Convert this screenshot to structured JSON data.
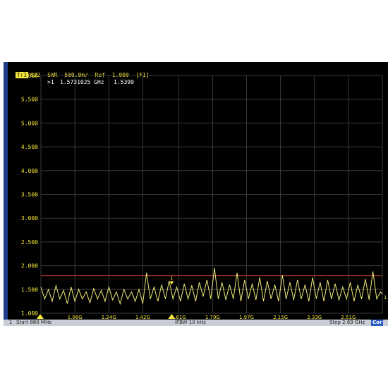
{
  "title_bar": {
    "trace": "Tr1",
    "text": "S22  SWR  500.0m/  Ref  1.000  [F1]"
  },
  "marker": {
    "readout_id": ">1",
    "readout_freq": "1.5731025 GHz",
    "readout_value": "1.5390",
    "label": "1",
    "end_label": "1"
  },
  "status_bar": {
    "channel": "1",
    "start": "Start 880 MHz",
    "ifbw": "IFBW 10 kHz",
    "stop": "Stop 2.69 GHz",
    "badge": "Cor"
  },
  "colors": {
    "trace": "#f0ea7a",
    "limit_line": "#b23a2a",
    "grid": "#3a3a3a",
    "axis_text": "#f4e83a"
  },
  "chart_data": {
    "type": "line",
    "title": "S22 SWR 500.0m/ Ref 1.000 [F1]",
    "xlabel": "",
    "ylabel": "",
    "xlim": [
      0.88,
      2.69
    ],
    "ylim": [
      1.0,
      6.0
    ],
    "y_ticks": [
      "6.000",
      "5.500",
      "5.000",
      "4.500",
      "4.000",
      "3.500",
      "3.000",
      "2.500",
      "2.000",
      "1.500",
      "1.000"
    ],
    "y_tick_values": [
      6.0,
      5.5,
      5.0,
      4.5,
      4.0,
      3.5,
      3.0,
      2.5,
      2.0,
      1.5,
      1.0
    ],
    "x_ticks": [
      "1.06G",
      "1.24G",
      "1.42G",
      "1.61G",
      "1.79G",
      "1.97G",
      "2.15G",
      "2.33G",
      "2.51G"
    ],
    "x_tick_values": [
      1.06,
      1.24,
      1.42,
      1.61,
      1.79,
      1.97,
      2.15,
      2.33,
      2.51
    ],
    "limit_line": 1.79,
    "marker_x": 1.5731025,
    "marker_y": 1.539,
    "grid": true,
    "series": [
      {
        "x": [
          0.88,
          0.9,
          0.92,
          0.94,
          0.96,
          0.98,
          1.0,
          1.02,
          1.04,
          1.06,
          1.08,
          1.1,
          1.12,
          1.14,
          1.16,
          1.18,
          1.2,
          1.22,
          1.24,
          1.26,
          1.28,
          1.3,
          1.32,
          1.34,
          1.36,
          1.38,
          1.4,
          1.42,
          1.44,
          1.46,
          1.48,
          1.5,
          1.52,
          1.54,
          1.56,
          1.58,
          1.6,
          1.62,
          1.64,
          1.66,
          1.68,
          1.7,
          1.72,
          1.74,
          1.76,
          1.78,
          1.8,
          1.82,
          1.84,
          1.86,
          1.88,
          1.9,
          1.92,
          1.94,
          1.96,
          1.98,
          2.0,
          2.02,
          2.04,
          2.06,
          2.08,
          2.1,
          2.12,
          2.14,
          2.16,
          2.18,
          2.2,
          2.22,
          2.24,
          2.26,
          2.28,
          2.3,
          2.32,
          2.34,
          2.36,
          2.38,
          2.4,
          2.42,
          2.44,
          2.46,
          2.48,
          2.5,
          2.52,
          2.54,
          2.56,
          2.58,
          2.6,
          2.62,
          2.64,
          2.66,
          2.68,
          2.69
        ],
        "y": [
          1.55,
          1.3,
          1.5,
          1.25,
          1.58,
          1.3,
          1.48,
          1.2,
          1.55,
          1.25,
          1.5,
          1.3,
          1.45,
          1.22,
          1.52,
          1.3,
          1.48,
          1.25,
          1.55,
          1.28,
          1.45,
          1.2,
          1.5,
          1.3,
          1.45,
          1.25,
          1.5,
          1.2,
          1.85,
          1.3,
          1.55,
          1.25,
          1.6,
          1.3,
          1.68,
          1.3,
          1.55,
          1.25,
          1.62,
          1.3,
          1.58,
          1.25,
          1.65,
          1.35,
          1.7,
          1.3,
          1.95,
          1.3,
          1.65,
          1.28,
          1.6,
          1.3,
          1.85,
          1.25,
          1.7,
          1.3,
          1.62,
          1.28,
          1.75,
          1.25,
          1.68,
          1.3,
          1.6,
          1.25,
          1.8,
          1.3,
          1.65,
          1.28,
          1.7,
          1.3,
          1.6,
          1.25,
          1.75,
          1.3,
          1.65,
          1.25,
          1.7,
          1.3,
          1.62,
          1.28,
          1.55,
          1.3,
          1.65,
          1.25,
          1.6,
          1.3,
          1.72,
          1.28,
          1.88,
          1.3,
          1.45,
          1.4
        ]
      }
    ]
  }
}
